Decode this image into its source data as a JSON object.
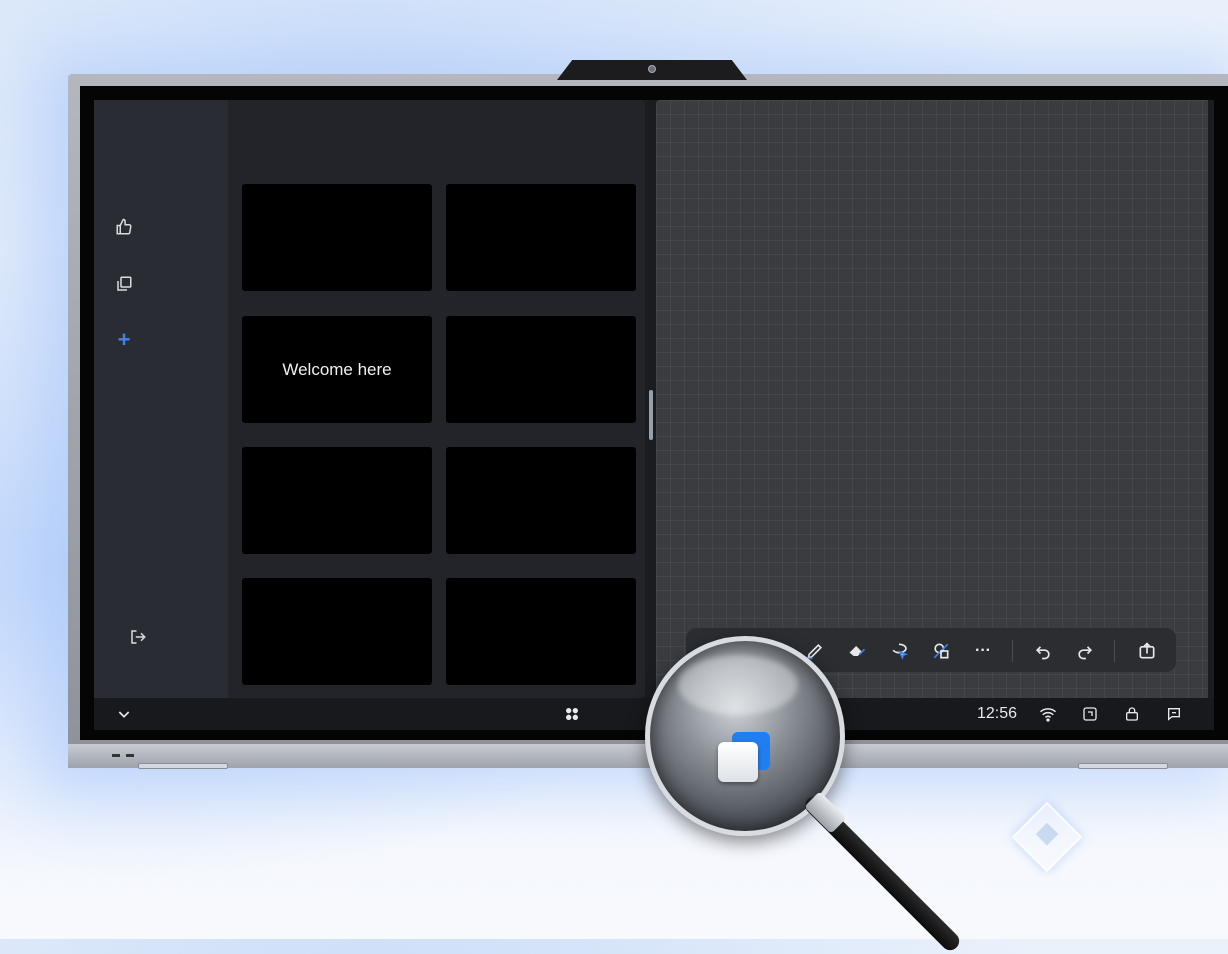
{
  "whiteboard": {
    "slide_text": "Welcome here"
  },
  "sidebar": {
    "items": [
      {
        "icon": "thumbs-up-icon"
      },
      {
        "icon": "copy-pages-icon"
      },
      {
        "icon": "plus-icon",
        "glyph": "+"
      },
      {
        "icon": "exit-icon"
      }
    ]
  },
  "toolbar": {
    "tools": [
      "pen-icon",
      "eraser-icon",
      "lasso-select-icon",
      "shape-recognize-icon",
      "more-icon",
      "undo-icon",
      "redo-icon",
      "export-icon"
    ],
    "more_glyph": "···"
  },
  "taskbar": {
    "time": "12:56",
    "collapse_glyph": "⌄",
    "icons": [
      "chevron-down-icon",
      "apps-icon",
      "wifi-icon",
      "screen-share-icon",
      "lock-icon",
      "feedback-icon"
    ]
  },
  "colors": {
    "accent": "#3d82f0",
    "panel": "#22242a",
    "canvas": "#3a3c40"
  }
}
